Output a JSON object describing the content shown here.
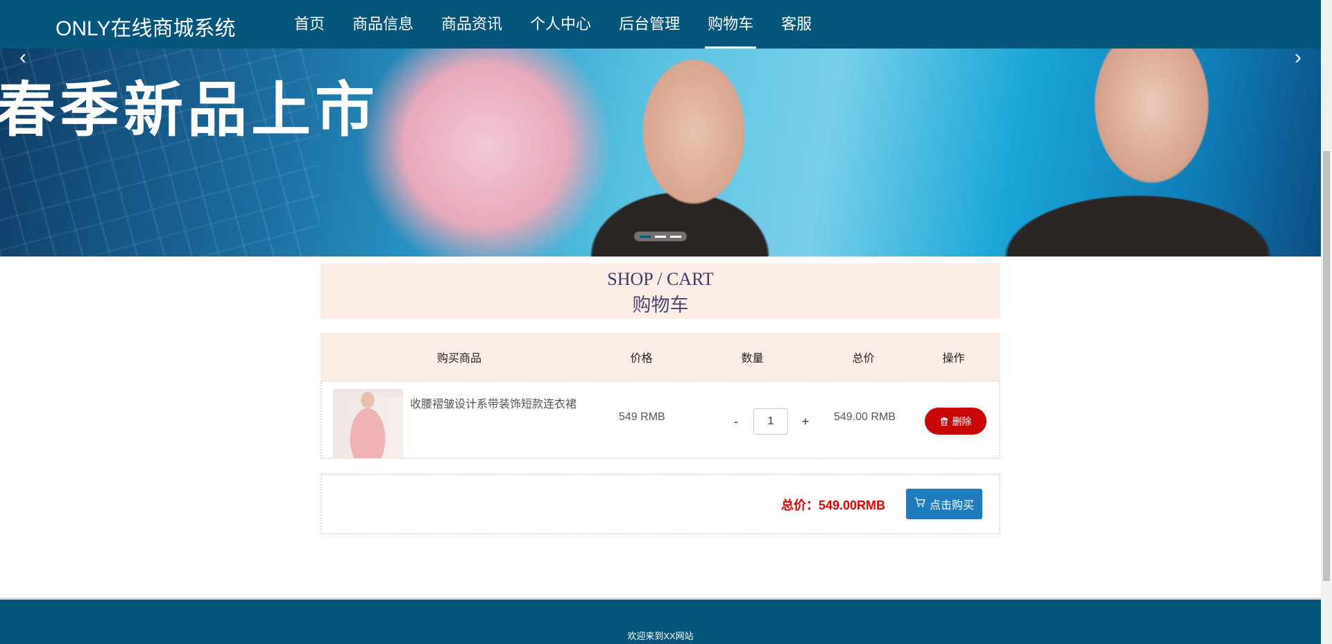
{
  "header": {
    "brand": "ONLY在线商城系统",
    "nav": [
      {
        "label": "首页"
      },
      {
        "label": "商品信息"
      },
      {
        "label": "商品资讯"
      },
      {
        "label": "个人中心"
      },
      {
        "label": "后台管理"
      },
      {
        "label": "购物车",
        "active": true
      },
      {
        "label": "客服"
      }
    ]
  },
  "banner": {
    "title": "春季新品上市",
    "prev_icon": "chevron-left-icon",
    "next_icon": "chevron-right-icon",
    "slides": 3,
    "active_slide": 1
  },
  "section": {
    "title_en": "SHOP / CART",
    "title_zh": "购物车"
  },
  "table": {
    "headers": {
      "product": "购买商品",
      "price": "价格",
      "quantity": "数量",
      "total": "总价",
      "operation": "操作"
    },
    "rows": [
      {
        "name": "收腰褶皱设计系带装饰短款连衣裙",
        "price": "549 RMB",
        "minus": "-",
        "quantity": "1",
        "plus": "+",
        "total": "549.00 RMB",
        "delete_label": "删除"
      }
    ]
  },
  "summary": {
    "total_label": "总价：549.00RMB",
    "buy_label": "点击购买"
  },
  "footer": {
    "text": "欢迎来到XX网站"
  },
  "colors": {
    "nav_bg": "#05567a",
    "section_bg": "#fcede6",
    "delete_btn": "#c9080a",
    "buy_btn": "#1f7dbd",
    "total_text": "#e60000"
  }
}
